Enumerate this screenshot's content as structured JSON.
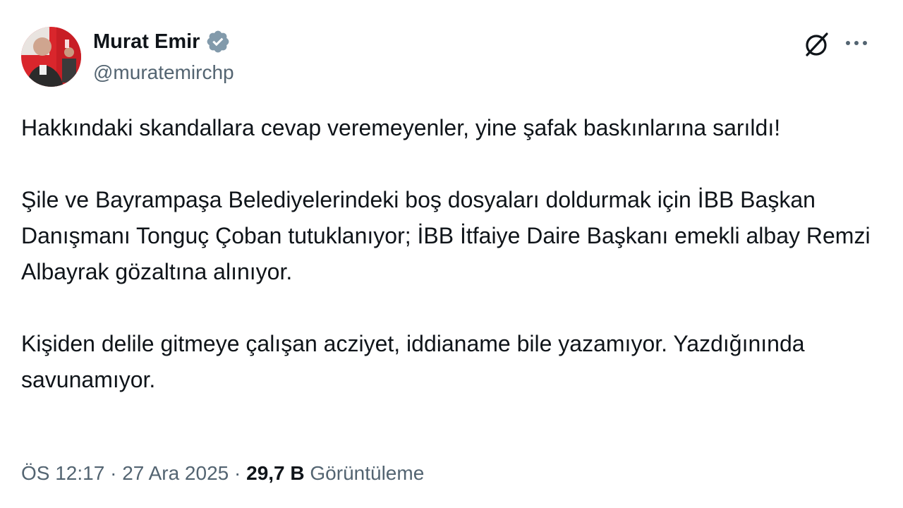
{
  "author": {
    "display_name": "Murat Emir",
    "handle": "@muratemirchp",
    "verified": true,
    "avatar": "profile-photo"
  },
  "header_actions": {
    "grok_icon": "grok-slash-icon",
    "more_icon": "more-horizontal-icon"
  },
  "tweet": {
    "paragraphs": [
      "Hakkındaki skandallara cevap veremeyenler, yine şafak baskınlarına sarıldı!",
      "Şile ve Bayrampaşa Belediyelerindeki boş dosyaları doldurmak için İBB Başkan Danışmanı Tonguç Çoban tutuklanıyor; İBB İtfaiye Daire Başkanı emekli albay Remzi Albayrak gözaltına alınıyor.",
      "Kişiden delile gitmeye çalışan acziyet, iddianame bile yazamıyor. Yazdığınında savunamıyor."
    ]
  },
  "meta": {
    "time": "ÖS 12:17",
    "separator": "·",
    "date": "27 Ara 2025",
    "views_count": "29,7 B",
    "views_label": "Görüntüleme"
  },
  "colors": {
    "text_primary": "#0f1419",
    "text_secondary": "#536471",
    "verified_badge": "#829aab"
  }
}
